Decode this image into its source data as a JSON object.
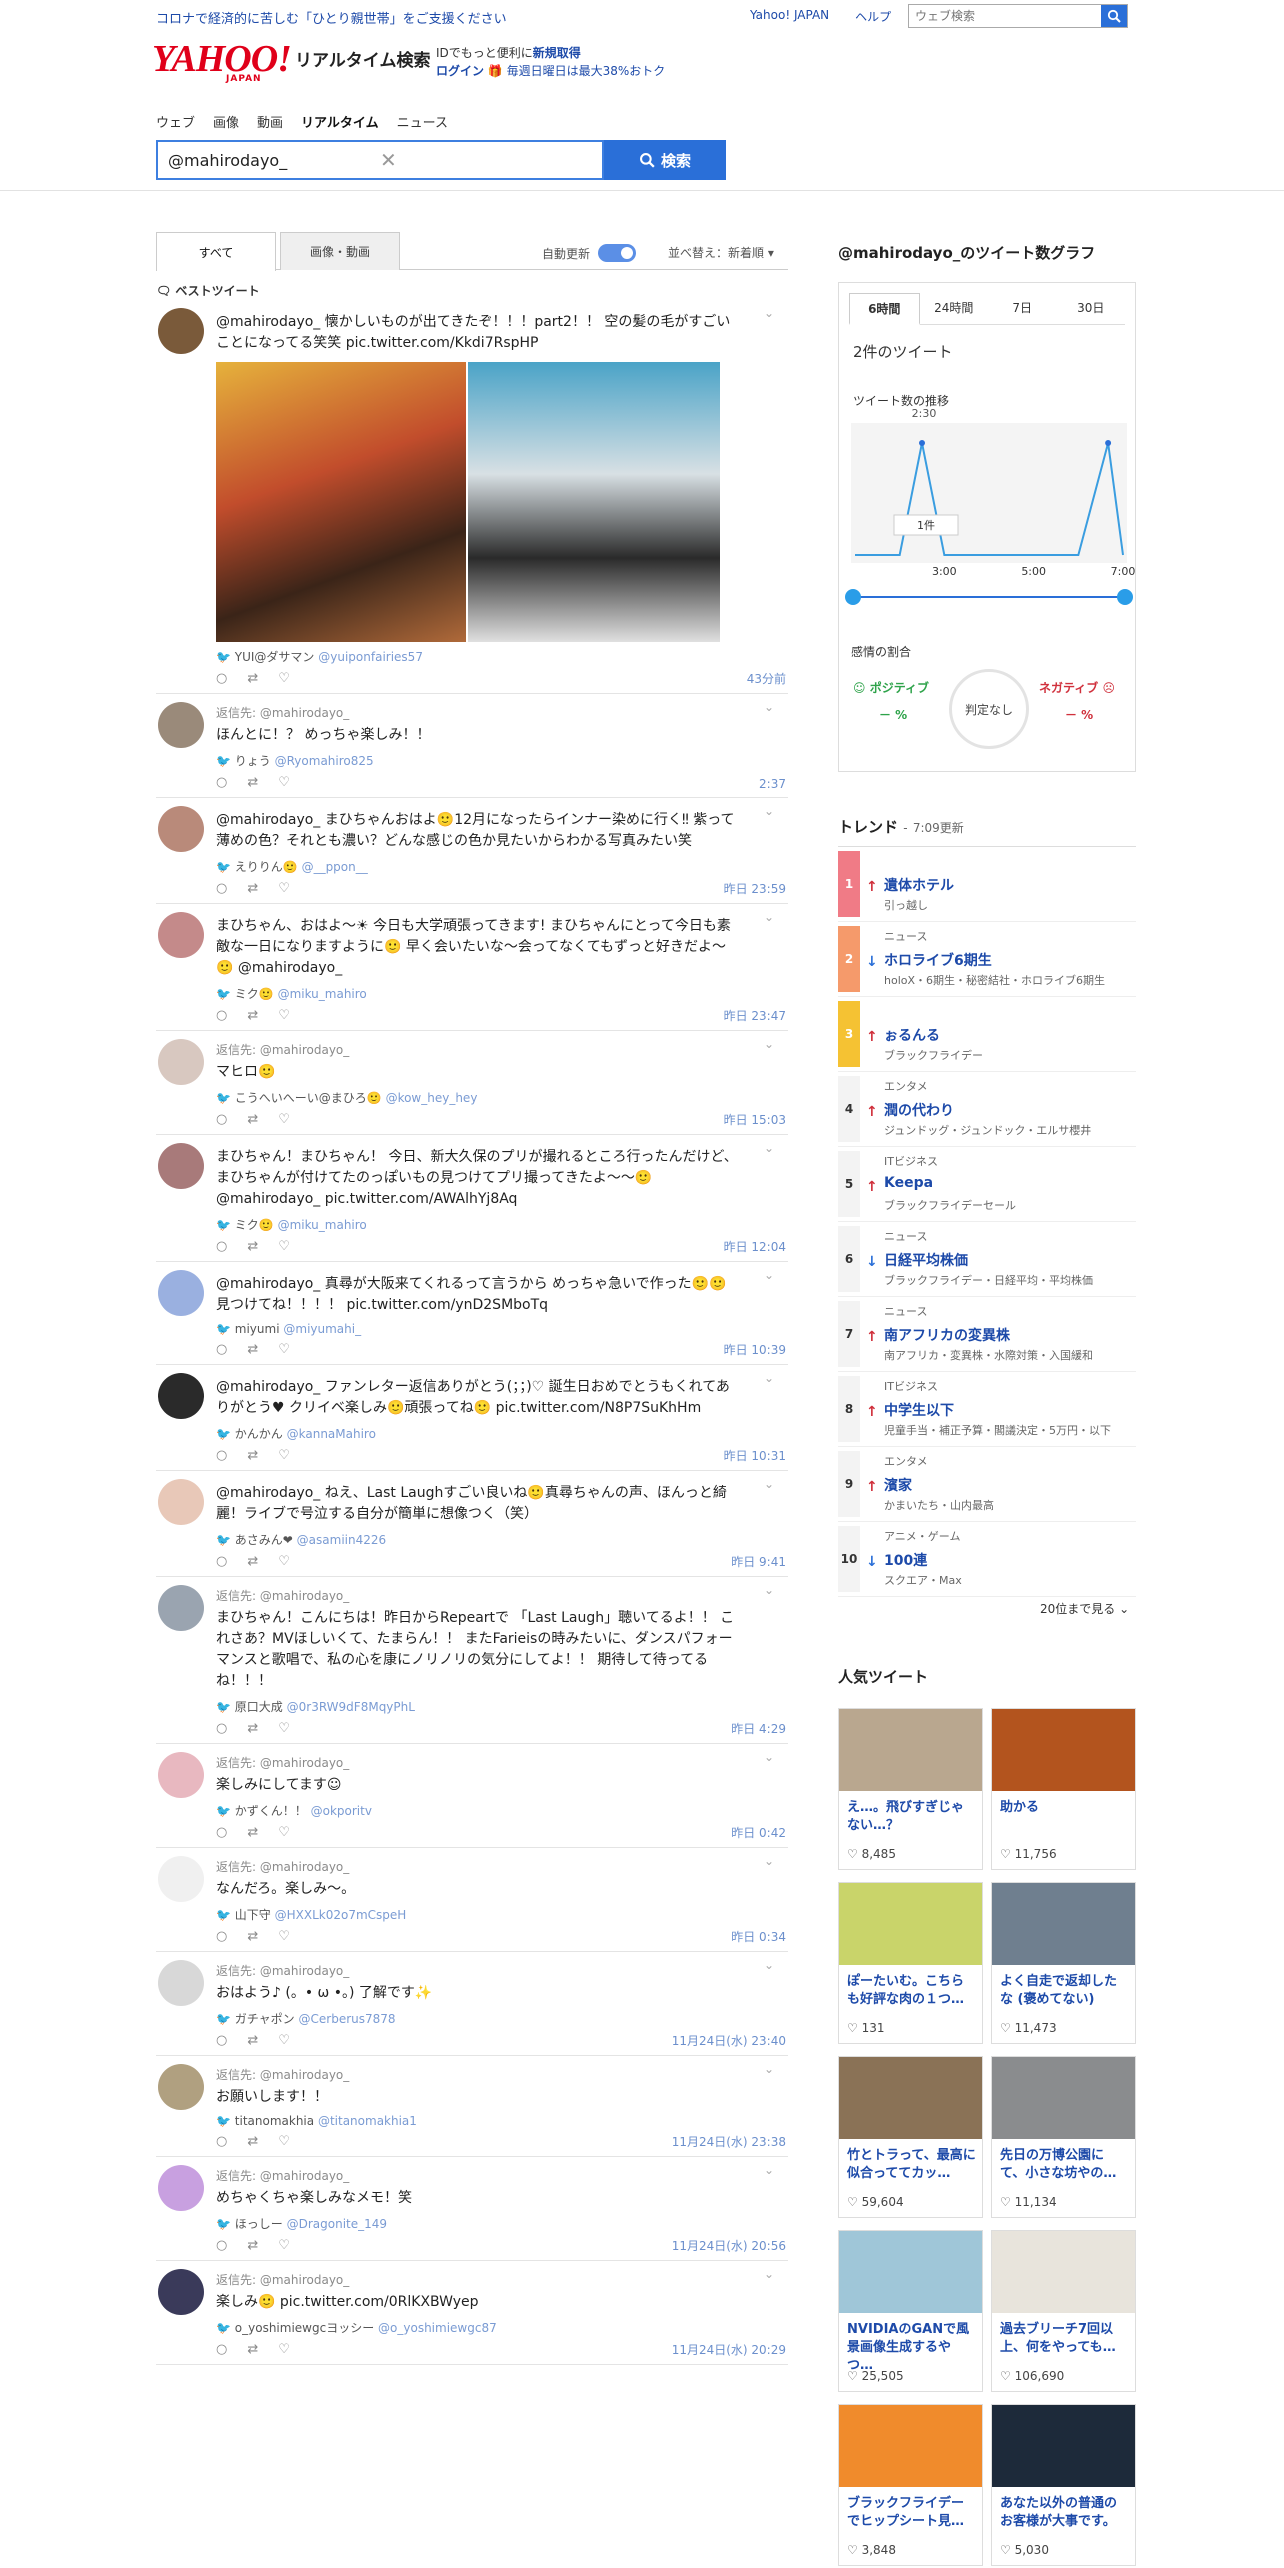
{
  "header": {
    "promo": "コロナで経済的に苦しむ「ひとり親世帯」をご支援ください",
    "links": [
      "Yahoo! JAPAN",
      "ヘルプ"
    ],
    "web_search_placeholder": "ウェブ検索",
    "logo": "YAHOO!",
    "logo_sub": "JAPAN",
    "service": "リアルタイム検索",
    "login_line1_pre": "IDでもっと便利に",
    "login_line1_link": "新規取得",
    "login_line2_link": "ログイン",
    "login_line2_post": "🎁 毎週日曜日は最大38%おトク"
  },
  "nav": [
    "ウェブ",
    "画像",
    "動画",
    "リアルタイム",
    "ニュース"
  ],
  "search": {
    "query": "@mahirodayo_",
    "button": "検索"
  },
  "tabs": {
    "all": "すべて",
    "media": "画像・動画",
    "auto": "自動更新",
    "sort": "並べ替え：新着順"
  },
  "best_label": "ベストツイート",
  "tweets": [
    {
      "reply": "",
      "text": "@mahirodayo_ 懐かしいものが出てきたぞ！！！part2！！ 空の髪の毛がすごいことになってる笑笑 pic.twitter.com/Kkdi7RspHP",
      "user": "YUI@ダサマン",
      "handle": "@yuiponfairies57",
      "time": "43分前"
    },
    {
      "reply": "返信先: @mahirodayo_",
      "text": "ほんとに！？ めっちゃ楽しみ！！",
      "user": "りょう",
      "handle": "@Ryomahiro825",
      "time": "2:37"
    },
    {
      "reply": "",
      "text": "@mahirodayo_ まひちゃんおはよ🙂12月になったらインナー染めに行く‼ 紫って薄めの色？それとも濃い？どんな感じの色か見たいからわかる写真みたい笑",
      "user": "えりりん🙂",
      "handle": "@__ppon__",
      "time": "昨日 23:59"
    },
    {
      "reply": "",
      "text": "まひちゃん、おはよ〜☀ 今日も大学頑張ってきます! まひちゃんにとって今日も素敵な一日になりますように🙂 早く会いたいな〜会ってなくてもずっと好きだよ〜🙂 @mahirodayo_",
      "user": "ミク🙂",
      "handle": "@miku_mahiro",
      "time": "昨日 23:47"
    },
    {
      "reply": "返信先: @mahirodayo_",
      "text": "マヒロ🙂",
      "user": "こうへいへーい@まひろ🙂",
      "handle": "@kow_hey_hey",
      "time": "昨日 15:03"
    },
    {
      "reply": "",
      "text": "まひちゃん！まひちゃん！ 今日、新大久保のプリが撮れるところ行ったんだけど、まひちゃんが付けてたのっぽいもの見つけてプリ撮ってきたよ〜〜🙂 @mahirodayo_ pic.twitter.com/AWAlhYj8Aq",
      "user": "ミク🙂",
      "handle": "@miku_mahiro",
      "time": "昨日 12:04"
    },
    {
      "reply": "",
      "text": "@mahirodayo_ 真尋が大阪来てくれるって言うから めっちゃ急いで作った🙂🙂 見つけてね！！！！ pic.twitter.com/ynD2SMboTq",
      "user": "miyumi",
      "handle": "@miyumahi_",
      "time": "昨日 10:39"
    },
    {
      "reply": "",
      "text": "@mahirodayo_ ファンレター返信ありがとう(；；)♡ 誕生日おめでとうもくれてありがとう♥ クリイベ楽しみ🙂頑張ってね🙂 pic.twitter.com/N8P7SuKhHm",
      "user": "かんかん",
      "handle": "@kannaMahiro",
      "time": "昨日 10:31"
    },
    {
      "reply": "",
      "text": "@mahirodayo_ ねえ、Last Laughすごい良いね🙂真尋ちゃんの声、ほんっと綺麗！ライブで号泣する自分が簡単に想像つく（笑）",
      "user": "あさみん❤",
      "handle": "@asamiin4226",
      "time": "昨日 9:41"
    },
    {
      "reply": "返信先: @mahirodayo_",
      "text": "まひちゃん！こんにちは！昨日からRepeartで 「Last Laugh」聴いてるよ！！ これさあ？MVほしいくて、たまらん！！ またFarieisの時みたいに、ダンスパフォーマンスと歌唱で、私の心を康にノリノリの気分にしてよ！！ 期待して待ってるね！！！",
      "user": "原口大成",
      "handle": "@0r3RW9dF8MqyPhL",
      "time": "昨日 4:29"
    },
    {
      "reply": "返信先: @mahirodayo_",
      "text": "楽しみにしてます☺",
      "user": "かずくん！！",
      "handle": "@okporitv",
      "time": "昨日 0:42"
    },
    {
      "reply": "返信先: @mahirodayo_",
      "text": "なんだろ。楽しみ〜。",
      "user": "山下守",
      "handle": "@HXXLk02o7mCspeH",
      "time": "昨日 0:34"
    },
    {
      "reply": "返信先: @mahirodayo_",
      "text": "おはよう♪ (。• ω •。) 了解です✨",
      "user": "ガチャポン",
      "handle": "@Cerberus7878",
      "time": "11月24日(水) 23:40"
    },
    {
      "reply": "返信先: @mahirodayo_",
      "text": "お願いします！！",
      "user": "titanomakhia",
      "handle": "@titanomakhia1",
      "time": "11月24日(水) 23:38"
    },
    {
      "reply": "返信先: @mahirodayo_",
      "text": "めちゃくちゃ楽しみなメモ！笑",
      "user": "ほっしー",
      "handle": "@Dragonite_149",
      "time": "11月24日(水) 20:56"
    },
    {
      "reply": "返信先: @mahirodayo_",
      "text": "楽しみ🙂 pic.twitter.com/0RlKXBWyep",
      "user": "o_yoshimiewgcヨッシー",
      "handle": "@o_yoshimiewgc87",
      "time": "11月24日(水) 20:29"
    }
  ],
  "graph": {
    "title": "@mahirodayo_のツイート数グラフ",
    "tabs": [
      "6時間",
      "24時間",
      "7日",
      "30日"
    ],
    "count": "2件のツイート",
    "trend_label": "ツイート数の推移",
    "peak_time": "2:30",
    "tooltip": "1件",
    "ticks": [
      "3:00",
      "5:00",
      "7:00"
    ],
    "emotion_label": "感情の割合",
    "positive": "ポジティブ",
    "negative": "ネガティブ",
    "positive_value": "－ %",
    "negative_value": "－ %",
    "judge": "判定なし"
  },
  "chart_data": {
    "type": "line",
    "x": [
      "1:00",
      "2:00",
      "2:30",
      "3:00",
      "4:00",
      "5:00",
      "6:00",
      "6:40",
      "7:00"
    ],
    "values": [
      0,
      0,
      1,
      0,
      0,
      0,
      0,
      1,
      0
    ],
    "xlabel": "",
    "ylabel": "",
    "ylim": [
      0,
      1
    ]
  },
  "trend": {
    "title": "トレンド",
    "updated": "7:09更新",
    "items": [
      {
        "rank": "1",
        "cat": "",
        "kw": "遺体ホテル",
        "sub": "引っ越し",
        "dir": "up",
        "color": "#f07b86"
      },
      {
        "rank": "2",
        "cat": "ニュース",
        "kw": "ホロライブ6期生",
        "sub": "holoX・6期生・秘密結社・ホロライブ6期生",
        "dir": "down",
        "color": "#f59a6b"
      },
      {
        "rank": "3",
        "cat": "",
        "kw": "ぉるんる",
        "sub": "ブラックフライデー",
        "dir": "up",
        "color": "#f5c233"
      },
      {
        "rank": "4",
        "cat": "エンタメ",
        "kw": "潤の代わり",
        "sub": "ジュンドッグ・ジュンドック・エルサ櫻井",
        "dir": "up",
        "color": ""
      },
      {
        "rank": "5",
        "cat": "ITビジネス",
        "kw": "Keepa",
        "sub": "ブラックフライデーセール",
        "dir": "up",
        "color": ""
      },
      {
        "rank": "6",
        "cat": "ニュース",
        "kw": "日経平均株価",
        "sub": "ブラックフライデー・日経平均・平均株価",
        "dir": "down",
        "color": ""
      },
      {
        "rank": "7",
        "cat": "ニュース",
        "kw": "南アフリカの変異株",
        "sub": "南アフリカ・変異株・水際対策・入国緩和",
        "dir": "up",
        "color": ""
      },
      {
        "rank": "8",
        "cat": "ITビジネス",
        "kw": "中学生以下",
        "sub": "児童手当・補正予算・閣議決定・5万円・以下",
        "dir": "up",
        "color": ""
      },
      {
        "rank": "9",
        "cat": "エンタメ",
        "kw": "濱家",
        "sub": "かまいたち・山内最高",
        "dir": "up",
        "color": ""
      },
      {
        "rank": "10",
        "cat": "アニメ・ゲーム",
        "kw": "100連",
        "sub": "スクエア・Max",
        "dir": "down",
        "color": ""
      }
    ],
    "more": "20位まで見る"
  },
  "popular": {
    "title": "人気ツイート",
    "items": [
      {
        "t": "え…。飛びすぎじゃない…？",
        "likes": "8,485",
        "bg": "#b9a78f"
      },
      {
        "t": "助かる",
        "likes": "11,756",
        "bg": "#b3541e"
      },
      {
        "t": "ぽーたいむ。こちらも好評な肉の１つ…",
        "likes": "131",
        "bg": "#c9d46a"
      },
      {
        "t": "よく自走で返却したな (褒めてない)",
        "likes": "11,473",
        "bg": "#6f7f8f"
      },
      {
        "t": "竹とトラって、最高に似合っててカッ…",
        "likes": "59,604",
        "bg": "#8a7256"
      },
      {
        "t": "先日の万博公園にて、小さな坊やの…",
        "likes": "11,134",
        "bg": "#8a8c8e"
      },
      {
        "t": "NVIDIAのGANで風景画像生成するやつ…",
        "likes": "25,505",
        "bg": "#9fc6d8"
      },
      {
        "t": "過去ブリーチ7回以上、何をやっても…",
        "likes": "106,690",
        "bg": "#e8e4dc"
      },
      {
        "t": "ブラックフライデーでヒップシート見…",
        "likes": "3,848",
        "bg": "#f08b2c"
      },
      {
        "t": "あなた以外の普通のお客様が大事です。",
        "likes": "5,030",
        "bg": "#1d2a3a"
      }
    ]
  }
}
